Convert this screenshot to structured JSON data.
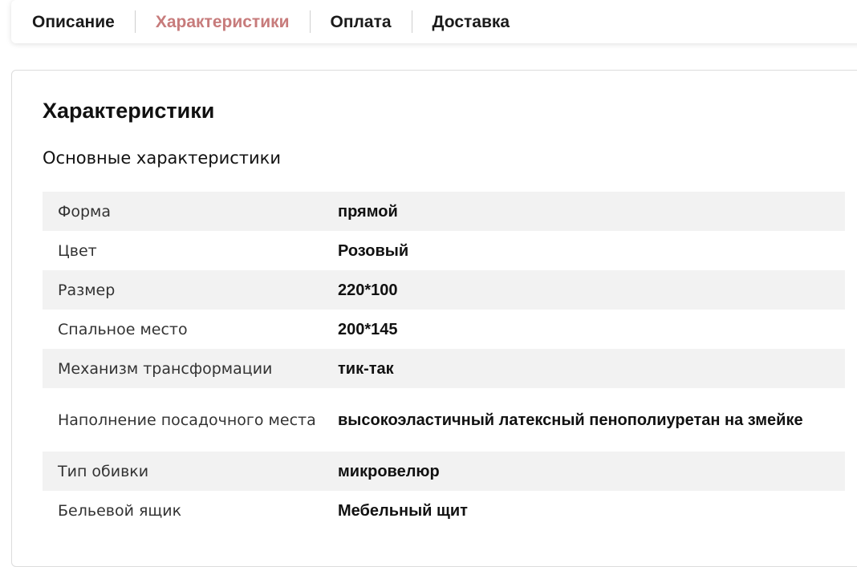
{
  "tabs": [
    {
      "label": "Описание",
      "active": false
    },
    {
      "label": "Характеристики",
      "active": true
    },
    {
      "label": "Оплата",
      "active": false
    },
    {
      "label": "Доставка",
      "active": false
    }
  ],
  "colors": {
    "active_tab": "#c77b7b",
    "row_alt_background": "#f2f2f2",
    "text": "#111111"
  },
  "characteristics": {
    "title": "Характеристики",
    "subtitle": "Основные характеристики",
    "rows": [
      {
        "label": "Форма",
        "value": "прямой"
      },
      {
        "label": "Цвет",
        "value": "Розовый"
      },
      {
        "label": "Размер",
        "value": "220*100"
      },
      {
        "label": "Спальное место",
        "value": "200*145"
      },
      {
        "label": "Механизм трансформации",
        "value": "тик-так"
      },
      {
        "label": "Наполнение посадочного места",
        "value": "высокоэластичный латексный пенополиуретан на змейке"
      },
      {
        "label": "Тип обивки",
        "value": "микровелюр"
      },
      {
        "label": "Бельевой ящик",
        "value": "Мебельный щит"
      }
    ]
  }
}
